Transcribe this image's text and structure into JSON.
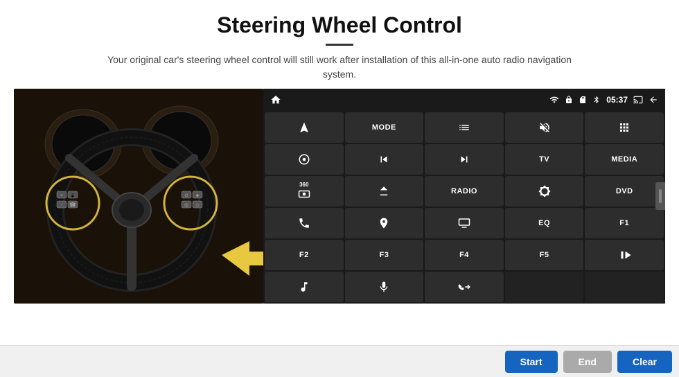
{
  "header": {
    "title": "Steering Wheel Control",
    "subtitle": "Your original car's steering wheel control will still work after installation of this all-in-one auto radio navigation system."
  },
  "statusbar": {
    "time": "05:37",
    "icons": [
      "wifi",
      "lock",
      "sd-card",
      "bluetooth",
      "battery",
      "screen-cast",
      "back"
    ]
  },
  "radio_buttons": [
    {
      "id": "row1",
      "buttons": [
        {
          "label": "",
          "icon": "home",
          "col": 1
        },
        {
          "label": "MODE",
          "icon": "",
          "col": 1
        },
        {
          "label": "",
          "icon": "list",
          "col": 1
        },
        {
          "label": "",
          "icon": "vol-mute",
          "col": 1
        },
        {
          "label": "",
          "icon": "apps",
          "col": 1
        }
      ]
    },
    {
      "id": "row2",
      "buttons": [
        {
          "label": "",
          "icon": "settings-circle",
          "col": 1
        },
        {
          "label": "",
          "icon": "prev",
          "col": 1
        },
        {
          "label": "",
          "icon": "next",
          "col": 1
        },
        {
          "label": "TV",
          "icon": "",
          "col": 1
        },
        {
          "label": "MEDIA",
          "icon": "",
          "col": 1
        }
      ]
    },
    {
      "id": "row3",
      "buttons": [
        {
          "label": "",
          "icon": "360-cam",
          "col": 1
        },
        {
          "label": "",
          "icon": "eject",
          "col": 1
        },
        {
          "label": "RADIO",
          "icon": "",
          "col": 1
        },
        {
          "label": "",
          "icon": "brightness",
          "col": 1
        },
        {
          "label": "DVD",
          "icon": "",
          "col": 1
        }
      ]
    },
    {
      "id": "row4",
      "buttons": [
        {
          "label": "",
          "icon": "phone",
          "col": 1
        },
        {
          "label": "",
          "icon": "globe",
          "col": 1
        },
        {
          "label": "",
          "icon": "screen",
          "col": 1
        },
        {
          "label": "EQ",
          "icon": "",
          "col": 1
        },
        {
          "label": "F1",
          "icon": "",
          "col": 1
        }
      ]
    },
    {
      "id": "row5",
      "buttons": [
        {
          "label": "F2",
          "icon": "",
          "col": 1
        },
        {
          "label": "F3",
          "icon": "",
          "col": 1
        },
        {
          "label": "F4",
          "icon": "",
          "col": 1
        },
        {
          "label": "F5",
          "icon": "",
          "col": 1
        },
        {
          "label": "",
          "icon": "play-pause",
          "col": 1
        }
      ]
    },
    {
      "id": "row6",
      "buttons": [
        {
          "label": "",
          "icon": "music",
          "col": 1
        },
        {
          "label": "",
          "icon": "mic",
          "col": 1
        },
        {
          "label": "",
          "icon": "call-end",
          "col": 1
        },
        {
          "label": "",
          "icon": "",
          "col": 2
        }
      ]
    }
  ],
  "bottom_buttons": {
    "start": "Start",
    "end": "End",
    "clear": "Clear"
  }
}
